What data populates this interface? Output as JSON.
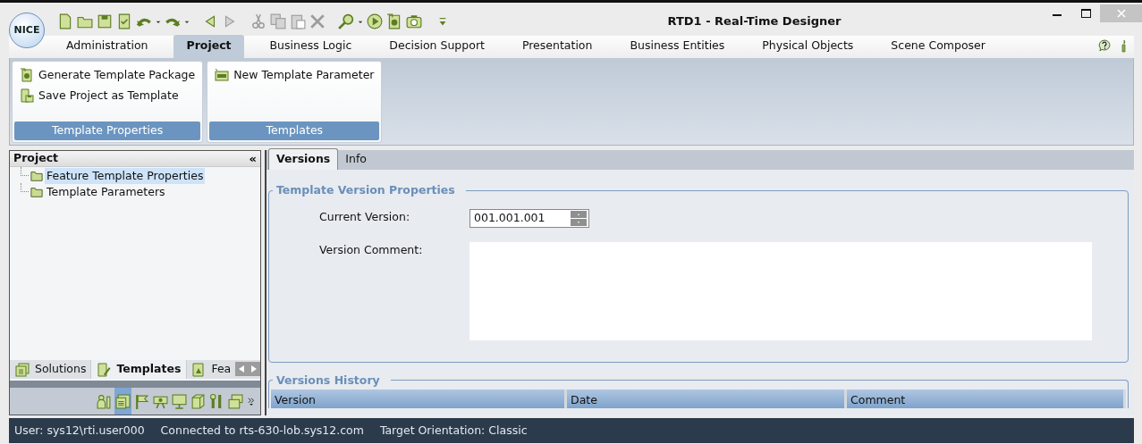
{
  "window": {
    "title": "RTD1 - Real-Time Designer",
    "logo": "NICE"
  },
  "toolbar": [
    {
      "kind": "new",
      "disabled": false,
      "dropdown": false
    },
    {
      "kind": "open",
      "disabled": false,
      "dropdown": false
    },
    {
      "kind": "save",
      "disabled": false,
      "dropdown": false
    },
    {
      "kind": "check",
      "disabled": false,
      "dropdown": false
    },
    {
      "kind": "undo",
      "disabled": false,
      "dropdown": true
    },
    {
      "kind": "redo",
      "disabled": false,
      "dropdown": true
    },
    {
      "kind": "back",
      "disabled": false,
      "dropdown": false
    },
    {
      "kind": "forward",
      "disabled": true,
      "dropdown": false
    },
    {
      "kind": "cut",
      "disabled": true,
      "dropdown": false
    },
    {
      "kind": "copy",
      "disabled": true,
      "dropdown": false
    },
    {
      "kind": "paste",
      "disabled": true,
      "dropdown": false
    },
    {
      "kind": "delete",
      "disabled": true,
      "dropdown": false
    },
    {
      "kind": "search",
      "disabled": false,
      "dropdown": true
    },
    {
      "kind": "run",
      "disabled": false,
      "dropdown": false
    },
    {
      "kind": "package",
      "disabled": false,
      "dropdown": false
    },
    {
      "kind": "camera",
      "disabled": false,
      "dropdown": false
    },
    {
      "kind": "overflow",
      "disabled": false,
      "dropdown": false
    }
  ],
  "menu_tabs": [
    {
      "label": "Administration",
      "selected": false
    },
    {
      "label": "Project",
      "selected": true
    },
    {
      "label": "Business Logic",
      "selected": false
    },
    {
      "label": "Decision Support",
      "selected": false
    },
    {
      "label": "Presentation",
      "selected": false
    },
    {
      "label": "Business Entities",
      "selected": false
    },
    {
      "label": "Physical Objects",
      "selected": false
    },
    {
      "label": "Scene Composer",
      "selected": false
    }
  ],
  "ribbon_groups": [
    {
      "title": "Template Properties",
      "items": [
        {
          "label": "Generate Template Package",
          "kind": "package"
        },
        {
          "label": "Save Project as Template",
          "kind": "savetemplate"
        }
      ]
    },
    {
      "title": "Templates",
      "items": [
        {
          "label": "New Template Parameter",
          "kind": "parameter"
        }
      ]
    }
  ],
  "project_panel": {
    "title": "Project",
    "collapse": "«",
    "tree": [
      {
        "label": "Feature Template Properties",
        "selected": true
      },
      {
        "label": "Template Parameters",
        "selected": false
      }
    ],
    "tabs": [
      {
        "label": "Solutions",
        "kind": "solutions",
        "selected": false
      },
      {
        "label": "Templates",
        "kind": "templates",
        "selected": true
      },
      {
        "label": "Fea",
        "kind": "features",
        "selected": false
      }
    ],
    "bottom_toolbar": [
      {
        "kind": "users",
        "selected": false
      },
      {
        "kind": "list",
        "selected": true
      },
      {
        "kind": "flag",
        "selected": false
      },
      {
        "kind": "projector",
        "selected": false
      },
      {
        "kind": "monitor",
        "selected": false
      },
      {
        "kind": "cube",
        "selected": false
      },
      {
        "kind": "tools",
        "selected": false
      },
      {
        "kind": "windows",
        "selected": false
      },
      {
        "kind": "more",
        "selected": false
      }
    ]
  },
  "content_tabs": [
    {
      "label": "Versions",
      "selected": true
    },
    {
      "label": "Info",
      "selected": false
    }
  ],
  "version_properties": {
    "legend": "Template Version Properties",
    "current_version_label": "Current Version:",
    "current_version": "001.001.001",
    "comment_label": "Version Comment:"
  },
  "versions_history": {
    "legend": "Versions History",
    "columns": [
      "Version",
      "Date",
      "Comment"
    ]
  },
  "status_bar": [
    "User: sys12\\rti.user000",
    "Connected to rts-630-lob.sys12.com",
    "Target Orientation: Classic"
  ]
}
